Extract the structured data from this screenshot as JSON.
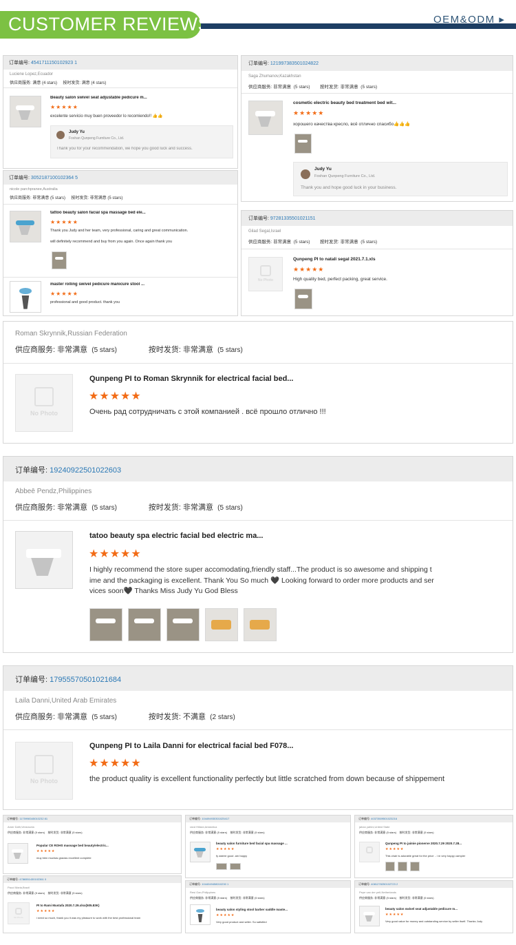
{
  "header": {
    "title": "CUSTOMER REVIEWS",
    "oem": "OEM&ODM ▸"
  },
  "labels": {
    "order_no": "订单编号:",
    "supplier": "供应商服务:",
    "delivery": "按时发货:"
  },
  "cards": {
    "c1": {
      "order": "4541711150102923 1",
      "buyer": "Luciene Lopez,Ecuador",
      "supplier_rating": "满意",
      "supplier_stars": "(4 stars)",
      "delivery_rating": "满意",
      "delivery_stars": "(4 stars)",
      "product": "Beauty salon swivel seat adjustable pedicure m...",
      "stars": "★★★★★",
      "review": "excelente servicio muy buen proveedor lo recomiendo!! 👍👍",
      "reply_name": "Judy Yu",
      "reply_company": "Foshan Qunpeng Furniture Co., Ltd.",
      "reply_text": "Thank you for your recommendation, we hope you good luck and success."
    },
    "c2": {
      "order": "121997383501024822",
      "buyer": "Saga Zhumanov,Kazakhstan",
      "supplier_rating": "非常满意",
      "supplier_stars": "(5 stars)",
      "delivery_rating": "非常满意",
      "delivery_stars": "(5 stars)",
      "product": "cosmetic electric beauty bed treatment bed wit...",
      "stars": "★★★★★",
      "review": "хорошего качества кресло, всё отлично спасибо👍👍👍",
      "reply_name": "Judy Yu",
      "reply_company": "Foshan Qunpeng Furniture Co., Ltd.",
      "reply_text": "Thank you and hope good luck in your business."
    },
    "c3": {
      "order": "3052187100102364 5",
      "buyer": "nicole parchpranee,Australia",
      "supplier_rating": "非常满意",
      "supplier_stars": "(5 stars)",
      "delivery_rating": "非常满意",
      "delivery_stars": "(5 stars)",
      "product": "tattoo beauty salon facial spa massage bed ele...",
      "stars": "★★★★★",
      "review1": "Thank you Judy and her team, very professional, caring and great communication.",
      "review2": "will definitely recommend and buy from you again. Once again thank you",
      "product2": "master rolling swivel pedicure manicure stool ...",
      "stars2": "★★★★★",
      "review3": "professional and good product. thank you"
    },
    "c4": {
      "order": "97281335501021151",
      "buyer": "Gilad Segal,Israel",
      "supplier_rating": "非常满意",
      "supplier_stars": "(5 stars)",
      "delivery_rating": "非常满意",
      "delivery_stars": "(5 stars)",
      "product": "Qunpeng PI to natali segal 2021.7.1.xls",
      "stars": "★★★★★",
      "review": "High quality bed, perfect packing, great service.",
      "no_photo": "No Photo"
    },
    "c5": {
      "buyer": "Roman Skrynnik,Russian Federation",
      "supplier_rating": "非常满意",
      "supplier_stars": "(5 stars)",
      "delivery_rating": "非常满意",
      "delivery_stars": "(5 stars)",
      "product": "Qunpeng PI to Roman Skrynnik for electrical facial bed...",
      "stars": "★★★★★",
      "review": "Очень рад сотрудничать с этой компанией . всё прошло отлично !!!",
      "no_photo": "No Photo"
    },
    "c6": {
      "order": "19240922501022603",
      "buyer": "Abbeē Pendz,Philippines",
      "supplier_rating": "非常满意",
      "supplier_stars": "(5 stars)",
      "delivery_rating": "非常满意",
      "delivery_stars": "(5 stars)",
      "product": "tatoo beauty spa electric facial bed electric ma...",
      "stars": "★★★★★",
      "review1": "I highly recommend the store super accomodating,friendly staff...The product is so awesome and shipping t",
      "review2": "ime and the packaging is excellent. Thank You So much 🖤 Looking forward to order more products and ser",
      "review3": "vices soon🖤 Thanks Miss Judy Yu God Bless"
    },
    "c7": {
      "order": "17955570501021684",
      "buyer": "Laila Danni,United Arab Emirates",
      "supplier_rating": "非常满意",
      "supplier_stars": "(5 stars)",
      "delivery_rating": "不满意",
      "delivery_stars": "(2 stars)",
      "product": "Qunpeng PI to Laila Danni for electrical facial bed F078...",
      "stars": "★★★★★",
      "review": "the product quality is excellent functionality perfectly but little scratched from down because of shippement",
      "no_photo": "No Photo"
    }
  },
  "mini": {
    "m1": {
      "order": "1175998345010232 81",
      "buyer": "Amer Dafir,Venezuela",
      "product": "Popular CE ROHS massage bed beauty/electric...",
      "stars": "★★★★★",
      "review": "muy bien muchas gracias excellent complete",
      "s": "(5 stars)",
      "r": "非常满意"
    },
    "m2": {
      "order": "104494930301025417",
      "buyer": "rand Hillard,Antarctica",
      "product": "beauty salon furniture bed facial spa massage ...",
      "stars": "★★★★★",
      "review": "fy astere good .am happy",
      "s": "(5 stars)",
      "r": "非常满意"
    },
    "m3": {
      "order": "40373509501023216",
      "buyer": "jahan yahini,United State",
      "product": "Qunpeng PI to jaimie pionerve 2020.7.29 2020.7.28...",
      "stars": "★★★★★",
      "review": "This chair is adorable great for the price .. i m very happy campier",
      "s": "(5 stars)",
      "r": "非常满意"
    },
    "m4": {
      "order": "4786551430102361 0",
      "buyer": "Pacci Maria,Brazil",
      "product": "PI to Rami Mustafa 2020.7.29.xlsx(505.83K)",
      "stars": "★★★★★",
      "review": "i need so much, thank you it was my pleasure to work with the best professional team",
      "s": "(5 stars)",
      "r": "非常满意",
      "no_photo": "No Photo"
    },
    "m5": {
      "order": "1044049458010230 1",
      "buyer": "Resi Gan,Philippines",
      "product": "beauty salon styling stool barber saddle maste...",
      "stars": "★★★★★",
      "review": "Very good product and seller. So satisfied",
      "s": "(5 stars)",
      "r": "非常满意"
    },
    "m6": {
      "order": "4081278250102723 2",
      "buyer": "Pepe van der pelt,Netherlands",
      "product": "beauty salon swivel seat adjustable pedicure m...",
      "stars": "★★★★★",
      "review": "Very good value for money and outstanding service by seller itself. Thanks Judy",
      "s": "(5 stars)",
      "r": "非常满意"
    }
  }
}
